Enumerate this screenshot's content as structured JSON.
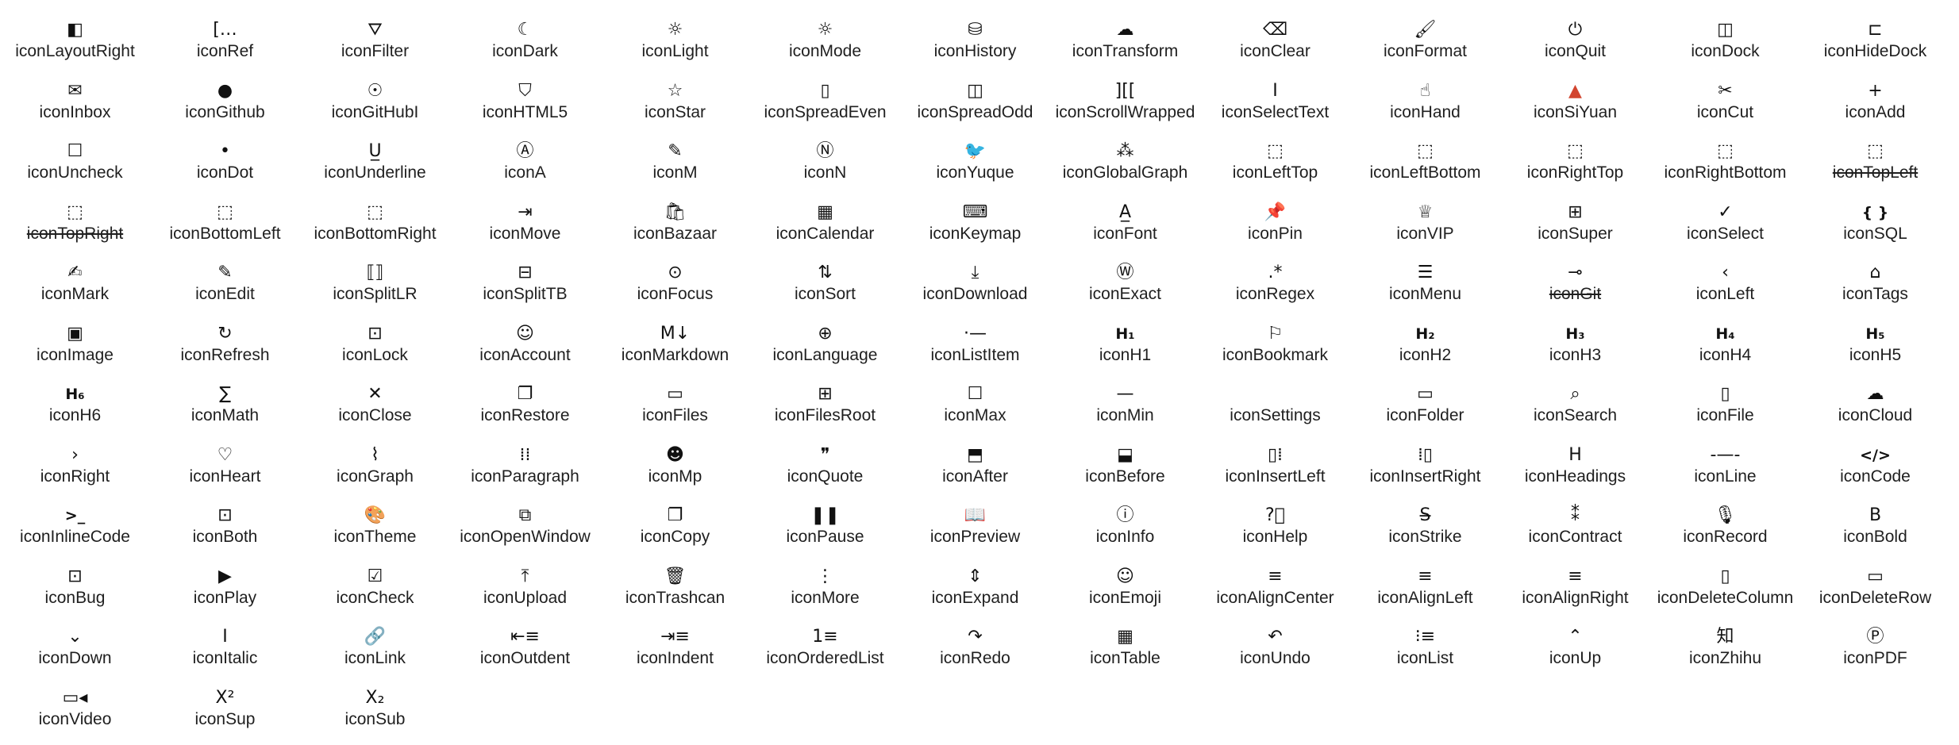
{
  "icons": [
    {
      "name": "iconLayoutRight",
      "glyph": "◧"
    },
    {
      "name": "iconRef",
      "glyph": "[…"
    },
    {
      "name": "iconFilter",
      "glyph": "⛛"
    },
    {
      "name": "iconDark",
      "glyph": "☾"
    },
    {
      "name": "iconLight",
      "glyph": "☼"
    },
    {
      "name": "iconMode",
      "glyph": "☼"
    },
    {
      "name": "iconHistory",
      "glyph": "⛁"
    },
    {
      "name": "iconTransform",
      "glyph": "☁"
    },
    {
      "name": "iconClear",
      "glyph": "⌫"
    },
    {
      "name": "iconFormat",
      "glyph": "🖌"
    },
    {
      "name": "iconQuit",
      "glyph": "⏻"
    },
    {
      "name": "iconDock",
      "glyph": "◫"
    },
    {
      "name": "iconHideDock",
      "glyph": "⊏"
    },
    {
      "name": "iconInbox",
      "glyph": "✉"
    },
    {
      "name": "iconGithub",
      "glyph": "●"
    },
    {
      "name": "iconGitHubI",
      "label": "iconGitHubI",
      "glyph": "☉"
    },
    {
      "name": "iconHTML5",
      "glyph": "⛉"
    },
    {
      "name": "iconStar",
      "glyph": "☆"
    },
    {
      "name": "iconSpreadEven",
      "glyph": "▯"
    },
    {
      "name": "iconSpreadOdd",
      "glyph": "◫"
    },
    {
      "name": "iconScrollWrapped",
      "glyph": "][["
    },
    {
      "name": "iconSelectText",
      "glyph": "I"
    },
    {
      "name": "iconHand",
      "glyph": "☝"
    },
    {
      "name": "iconSiYuan",
      "glyph": "▲"
    },
    {
      "name": "iconCut",
      "glyph": "✂"
    },
    {
      "name": "iconAdd",
      "glyph": "+"
    },
    {
      "name": "iconUncheck",
      "glyph": "☐"
    },
    {
      "name": "iconDot",
      "glyph": "•"
    },
    {
      "name": "iconUnderline",
      "glyph": "U̲"
    },
    {
      "name": "iconA",
      "glyph": "Ⓐ"
    },
    {
      "name": "iconM",
      "glyph": "✎"
    },
    {
      "name": "iconN",
      "glyph": "Ⓝ"
    },
    {
      "name": "iconYuque",
      "glyph": "🐦"
    },
    {
      "name": "iconGlobalGraph",
      "glyph": "⁂"
    },
    {
      "name": "iconLeftTop",
      "glyph": "⬚"
    },
    {
      "name": "iconLeftBottom",
      "glyph": "⬚"
    },
    {
      "name": "iconRightTop",
      "glyph": "⬚"
    },
    {
      "name": "iconRightBottom",
      "glyph": "⬚"
    },
    {
      "name": "iconTopLeft",
      "glyph": "⬚",
      "strike": true
    },
    {
      "name": "iconTopRight",
      "glyph": "⬚",
      "strike": true
    },
    {
      "name": "iconBottomLeft",
      "glyph": "⬚"
    },
    {
      "name": "iconBottomRight",
      "glyph": "⬚"
    },
    {
      "name": "iconMove",
      "glyph": "⇥"
    },
    {
      "name": "iconBazaar",
      "glyph": "🛍"
    },
    {
      "name": "iconCalendar",
      "glyph": "▦"
    },
    {
      "name": "iconKeymap",
      "glyph": "⌨"
    },
    {
      "name": "iconFont",
      "glyph": "A̲"
    },
    {
      "name": "iconPin",
      "glyph": "📌"
    },
    {
      "name": "iconVIP",
      "glyph": "♕"
    },
    {
      "name": "iconSuper",
      "glyph": "⊞"
    },
    {
      "name": "iconSelect",
      "glyph": "✓"
    },
    {
      "name": "iconSQL",
      "glyph": "{ }"
    },
    {
      "name": "iconMark",
      "glyph": "✍"
    },
    {
      "name": "iconEdit",
      "glyph": "✎"
    },
    {
      "name": "iconSplitLR",
      "glyph": "⟦⟧"
    },
    {
      "name": "iconSplitTB",
      "glyph": "⊟"
    },
    {
      "name": "iconFocus",
      "glyph": "⊙"
    },
    {
      "name": "iconSort",
      "glyph": "⇅"
    },
    {
      "name": "iconDownload",
      "glyph": "⤓"
    },
    {
      "name": "iconExact",
      "glyph": "Ⓦ"
    },
    {
      "name": "iconRegex",
      "glyph": ".*"
    },
    {
      "name": "iconMenu",
      "glyph": "☰"
    },
    {
      "name": "iconGit",
      "glyph": "⊸",
      "strike": true
    },
    {
      "name": "iconLeft",
      "glyph": "‹"
    },
    {
      "name": "iconTags",
      "glyph": "⌂"
    },
    {
      "name": "iconImage",
      "glyph": "▣"
    },
    {
      "name": "iconRefresh",
      "glyph": "↻"
    },
    {
      "name": "iconLock",
      "glyph": "⊡"
    },
    {
      "name": "iconAccount",
      "glyph": "☺"
    },
    {
      "name": "iconMarkdown",
      "glyph": "M↓"
    },
    {
      "name": "iconLanguage",
      "glyph": "⊕"
    },
    {
      "name": "iconListItem",
      "glyph": "·—"
    },
    {
      "name": "iconH1",
      "glyph": "H₁"
    },
    {
      "name": "iconBookmark",
      "glyph": "⚐"
    },
    {
      "name": "iconH2",
      "glyph": "H₂"
    },
    {
      "name": "iconH3",
      "glyph": "H₃"
    },
    {
      "name": "iconH4",
      "glyph": "H₄"
    },
    {
      "name": "iconH5",
      "glyph": "H₅"
    },
    {
      "name": "iconH6",
      "glyph": "H₆"
    },
    {
      "name": "iconMath",
      "glyph": "∑"
    },
    {
      "name": "iconClose",
      "glyph": "✕"
    },
    {
      "name": "iconRestore",
      "glyph": "❐"
    },
    {
      "name": "iconFiles",
      "glyph": "▭"
    },
    {
      "name": "iconFilesRoot",
      "glyph": "⊞"
    },
    {
      "name": "iconMax",
      "glyph": "☐"
    },
    {
      "name": "iconMin",
      "glyph": "—"
    },
    {
      "name": "iconSettings",
      "glyph": ""
    },
    {
      "name": "iconFolder",
      "glyph": "▭"
    },
    {
      "name": "iconSearch",
      "glyph": "⌕"
    },
    {
      "name": "iconFile",
      "glyph": "▯"
    },
    {
      "name": "iconCloud",
      "glyph": "☁"
    },
    {
      "name": "iconRight",
      "glyph": "›"
    },
    {
      "name": "iconHeart",
      "glyph": "♡"
    },
    {
      "name": "iconGraph",
      "glyph": "⌇"
    },
    {
      "name": "iconParagraph",
      "glyph": "⁞⁞"
    },
    {
      "name": "iconMp",
      "glyph": "☻"
    },
    {
      "name": "iconQuote",
      "glyph": "❞"
    },
    {
      "name": "iconAfter",
      "glyph": "⬒"
    },
    {
      "name": "iconBefore",
      "glyph": "⬓"
    },
    {
      "name": "iconInsertLeft",
      "glyph": "▯⁞"
    },
    {
      "name": "iconInsertRight",
      "glyph": "⁞▯"
    },
    {
      "name": "iconHeadings",
      "glyph": "H"
    },
    {
      "name": "iconLine",
      "glyph": "-—-"
    },
    {
      "name": "iconCode",
      "glyph": "</>"
    },
    {
      "name": "iconInlineCode",
      "glyph": ">_"
    },
    {
      "name": "iconBoth",
      "glyph": "⊡"
    },
    {
      "name": "iconTheme",
      "glyph": "🎨"
    },
    {
      "name": "iconOpenWindow",
      "glyph": "⧉"
    },
    {
      "name": "iconCopy",
      "glyph": "❐"
    },
    {
      "name": "iconPause",
      "glyph": "❚❚"
    },
    {
      "name": "iconPreview",
      "glyph": "📖"
    },
    {
      "name": "iconInfo",
      "glyph": "ⓘ"
    },
    {
      "name": "iconHelp",
      "glyph": "?⃝"
    },
    {
      "name": "iconStrike",
      "glyph": "S̶"
    },
    {
      "name": "iconContract",
      "glyph": "⁑"
    },
    {
      "name": "iconRecord",
      "glyph": "🎙"
    },
    {
      "name": "iconBold",
      "glyph": "B"
    },
    {
      "name": "iconBug",
      "glyph": "⊡"
    },
    {
      "name": "iconPlay",
      "glyph": "▶"
    },
    {
      "name": "iconCheck",
      "glyph": "☑"
    },
    {
      "name": "iconUpload",
      "glyph": "⤒"
    },
    {
      "name": "iconTrashcan",
      "glyph": "🗑"
    },
    {
      "name": "iconMore",
      "glyph": "⋮"
    },
    {
      "name": "iconExpand",
      "glyph": "⇕"
    },
    {
      "name": "iconEmoji",
      "glyph": "☺"
    },
    {
      "name": "iconAlignCenter",
      "glyph": "≡"
    },
    {
      "name": "iconAlignLeft",
      "glyph": "≡"
    },
    {
      "name": "iconAlignRight",
      "glyph": "≡"
    },
    {
      "name": "iconDeleteColumn",
      "glyph": "▯"
    },
    {
      "name": "iconDeleteRow",
      "glyph": "▭"
    },
    {
      "name": "iconDown",
      "glyph": "⌄"
    },
    {
      "name": "iconItalic",
      "glyph": "I"
    },
    {
      "name": "iconLink",
      "glyph": "🔗"
    },
    {
      "name": "iconOutdent",
      "glyph": "⇤≡"
    },
    {
      "name": "iconIndent",
      "glyph": "⇥≡"
    },
    {
      "name": "iconOrderedList",
      "glyph": "1≡"
    },
    {
      "name": "iconRedo",
      "glyph": "↷"
    },
    {
      "name": "iconTable",
      "glyph": "▦"
    },
    {
      "name": "iconUndo",
      "glyph": "↶"
    },
    {
      "name": "iconList",
      "glyph": "⁝≡"
    },
    {
      "name": "iconUp",
      "glyph": "⌃"
    },
    {
      "name": "iconZhihu",
      "glyph": "知"
    },
    {
      "name": "iconPDF",
      "glyph": "Ⓟ"
    },
    {
      "name": "iconVideo",
      "glyph": "▭◂"
    },
    {
      "name": "iconSup",
      "glyph": "X²"
    },
    {
      "name": "iconSub",
      "glyph": "X₂"
    }
  ]
}
